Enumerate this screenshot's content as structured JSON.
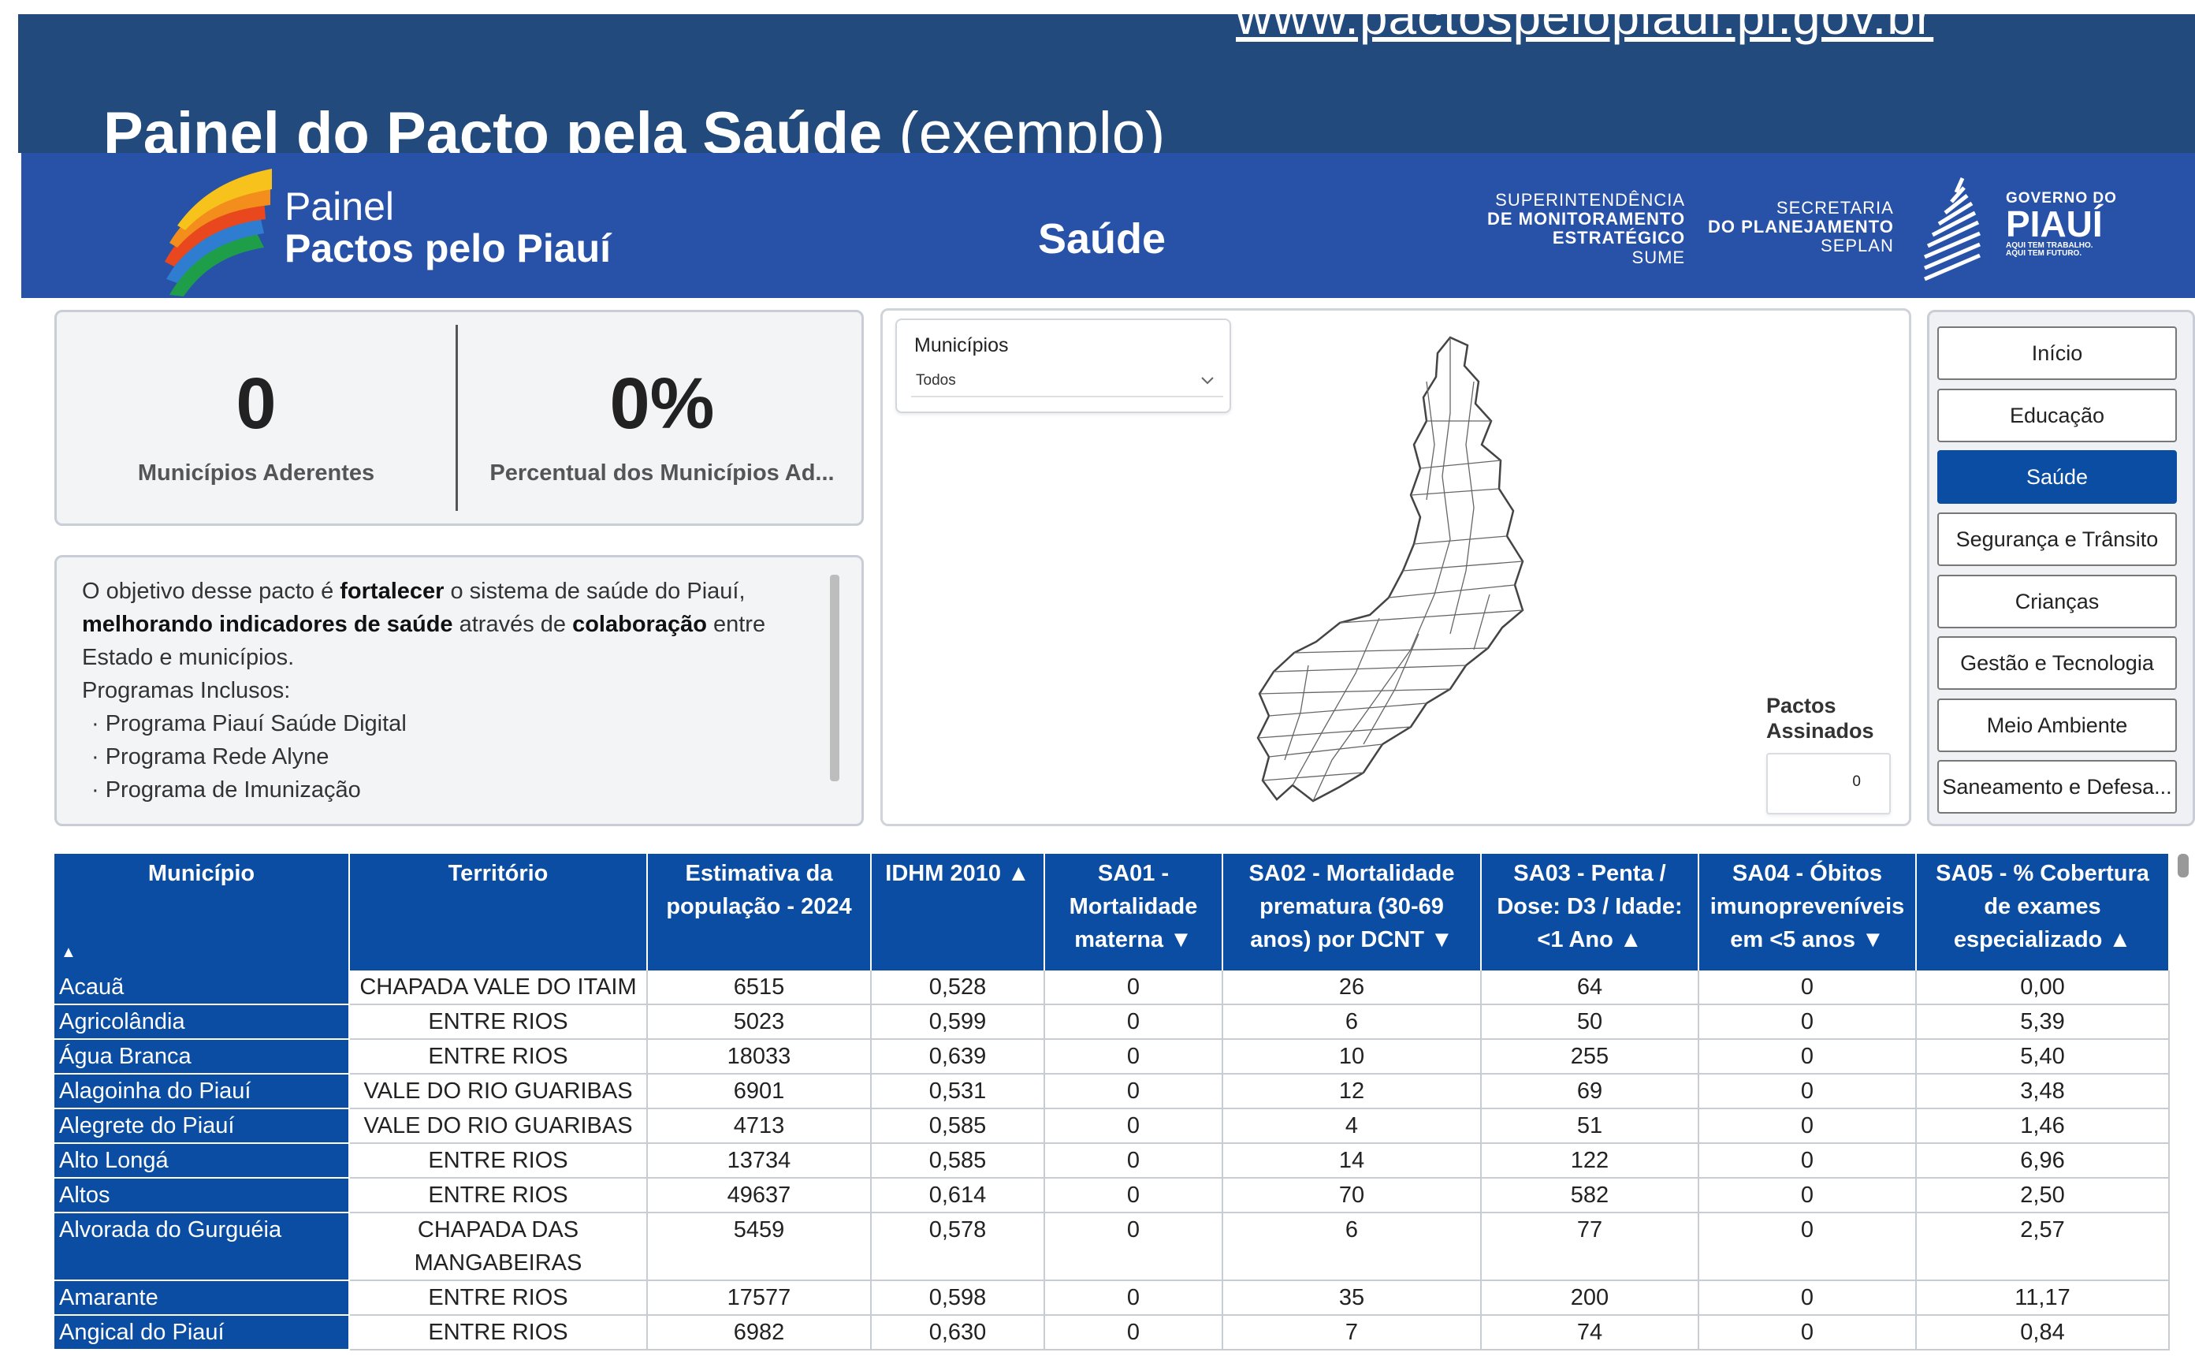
{
  "slide": {
    "url": "www.pactospelopiaui.pi.gov.br",
    "title_bold": "Painel do Pacto pela Saúde",
    "title_normal": "(exemplo)"
  },
  "header": {
    "brand_line1": "Painel",
    "brand_line2": "Pactos pelo Piauí",
    "page_title": "Saúde",
    "sume": [
      "SUPERINTENDÊNCIA",
      "DE MONITORAMENTO",
      "ESTRATÉGICO",
      "SUME"
    ],
    "seplan": [
      "SECRETARIA",
      "DO PLANEJAMENTO",
      "SEPLAN"
    ],
    "gov_line1": "GOVERNO DO",
    "gov_line2": "PIAUÍ",
    "gov_line3": "AQUI TEM TRABALHO.",
    "gov_line4": "AQUI TEM FUTURO."
  },
  "kpis": [
    {
      "value": "0",
      "label": "Municípios Aderentes"
    },
    {
      "value": "0%",
      "label": "Percentual dos Municípios Ad..."
    }
  ],
  "description": {
    "p1": "O objetivo desse pacto é ",
    "p1_bold": "fortalecer",
    "p2": " o sistema de saúde do Piauí, ",
    "p2_bold": "melhorando indicadores de saúde",
    "p3": " através de ",
    "p3_bold": "colaboração",
    "p4": " entre Estado e municípios.",
    "programs_label": "Programas Inclusos:",
    "programs": [
      "· Programa Piauí Saúde Digital",
      "· Programa Rede Alyne",
      "· Programa de Imunização"
    ]
  },
  "map_panel": {
    "slicer_label": "Municípios",
    "slicer_value": "Todos",
    "pactos_label_1": "Pactos",
    "pactos_label_2": "Assinados",
    "pactos_value": "0"
  },
  "nav": {
    "items": [
      {
        "label": "Início",
        "active": false
      },
      {
        "label": "Educação",
        "active": false
      },
      {
        "label": "Saúde",
        "active": true
      },
      {
        "label": "Segurança e Trânsito",
        "active": false
      },
      {
        "label": "Crianças",
        "active": false
      },
      {
        "label": "Gestão e Tecnologia",
        "active": false
      },
      {
        "label": "Meio Ambiente",
        "active": false
      },
      {
        "label": "Saneamento e Defesa...",
        "active": false
      }
    ]
  },
  "table": {
    "columns": [
      "Município",
      "Território",
      "Estimativa da população - 2024",
      "IDHM 2010 ▲",
      "SA01 - Mortalidade materna ▼",
      "SA02 - Mortalidade prematura (30-69 anos) por DCNT ▼",
      "SA03 - Penta / Dose: D3 / Idade: <1 Ano ▲",
      "SA04 - Óbitos imunopreveníveis em <5 anos ▼",
      "SA05 - % Cobertura de exames especializado ▲"
    ],
    "sort_indicator": "▲",
    "rows": [
      [
        "Acauã",
        "CHAPADA VALE DO ITAIM",
        "6515",
        "0,528",
        "0",
        "26",
        "64",
        "0",
        "0,00"
      ],
      [
        "Agricolândia",
        "ENTRE RIOS",
        "5023",
        "0,599",
        "0",
        "6",
        "50",
        "0",
        "5,39"
      ],
      [
        "Água Branca",
        "ENTRE RIOS",
        "18033",
        "0,639",
        "0",
        "10",
        "255",
        "0",
        "5,40"
      ],
      [
        "Alagoinha do Piauí",
        "VALE DO RIO GUARIBAS",
        "6901",
        "0,531",
        "0",
        "12",
        "69",
        "0",
        "3,48"
      ],
      [
        "Alegrete do Piauí",
        "VALE DO RIO GUARIBAS",
        "4713",
        "0,585",
        "0",
        "4",
        "51",
        "0",
        "1,46"
      ],
      [
        "Alto Longá",
        "ENTRE RIOS",
        "13734",
        "0,585",
        "0",
        "14",
        "122",
        "0",
        "6,96"
      ],
      [
        "Altos",
        "ENTRE RIOS",
        "49637",
        "0,614",
        "0",
        "70",
        "582",
        "0",
        "2,50"
      ],
      [
        "Alvorada do Gurguéia",
        "CHAPADA DAS MANGABEIRAS",
        "5459",
        "0,578",
        "0",
        "6",
        "77",
        "0",
        "2,57"
      ],
      [
        "Amarante",
        "ENTRE RIOS",
        "17577",
        "0,598",
        "0",
        "35",
        "200",
        "0",
        "11,17"
      ],
      [
        "Angical do Piauí",
        "ENTRE RIOS",
        "6982",
        "0,630",
        "0",
        "7",
        "74",
        "0",
        "0,84"
      ]
    ]
  },
  "colors": {
    "slide_band": "#234A7C",
    "header": "#2852A8",
    "accent": "#0A4DA2",
    "card_bg": "#F2F4F6"
  }
}
